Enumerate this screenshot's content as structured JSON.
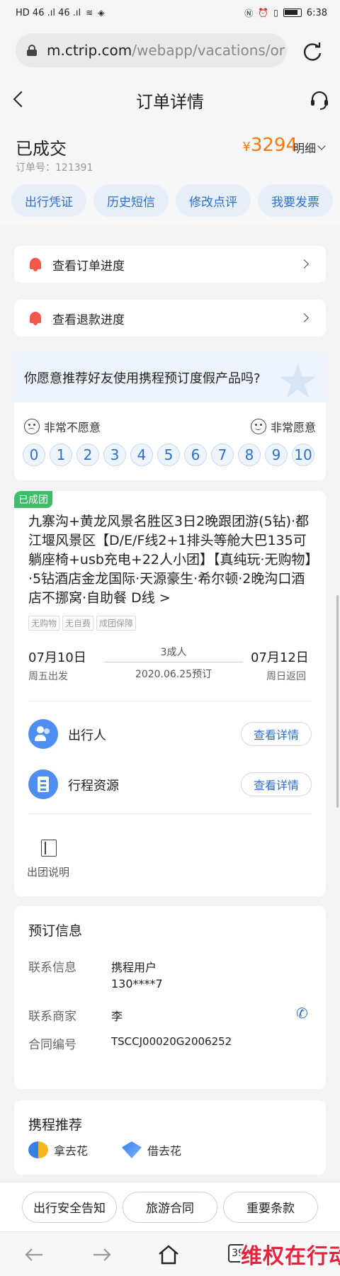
{
  "statusbar": {
    "left": "HD  46 .ıl  46 .ıl",
    "time": "6:38"
  },
  "url": {
    "host": "m.ctrip.com",
    "path": "/webapp/vacations/or"
  },
  "header": {
    "title": "订单详情"
  },
  "summary": {
    "status": "已成交",
    "order_label": "订单号：",
    "order_no": "121391",
    "price_currency": "¥",
    "price": "3294",
    "detail_label": "明细",
    "actions": [
      "出行凭证",
      "历史短信",
      "修改点评",
      "我要发票"
    ]
  },
  "progress": {
    "order": "查看订单进度",
    "refund": "查看退款进度"
  },
  "survey": {
    "question": "你愿意推荐好友使用携程预订度假产品吗?",
    "low_label": "非常不愿意",
    "high_label": "非常愿意",
    "scale": [
      "0",
      "1",
      "2",
      "3",
      "4",
      "5",
      "6",
      "7",
      "8",
      "9",
      "10"
    ]
  },
  "product": {
    "badge": "已成团",
    "title": "九寨沟+黄龙风景名胜区3日2晚跟团游(5钻)·都江堰风景区【D/E/F线2+1排头等舱大巴135可躺座椅+usb充电+22人小团】【真纯玩·无购物】·5钻酒店金龙国际·天源豪生·希尔顿·2晚沟口酒店不挪窝·自助餐 D线 >",
    "chips": [
      "无购物",
      "无自费",
      "成团保障"
    ],
    "start_date": "07月10日",
    "start_week": "周五出发",
    "people": "3成人",
    "booked": "2020.06.25预订",
    "end_date": "07月12日",
    "end_week": "周日返回",
    "traveler_label": "出行人",
    "resource_label": "行程资源",
    "view_details": "查看详情",
    "tour_notes": "出团说明"
  },
  "booking": {
    "title": "预订信息",
    "contact_label": "联系信息",
    "contact_name": "携程用户",
    "contact_phone": "130****7",
    "merchant_label": "联系商家",
    "merchant_name": "李",
    "contract_label": "合同编号",
    "contract_no": "TSCCJ00020G2006252"
  },
  "recommend": {
    "title": "携程推荐",
    "items": [
      "拿去花",
      "借去花"
    ]
  },
  "bottom": {
    "buttons": [
      "出行安全告知",
      "旅游合同",
      "重要条款"
    ]
  },
  "nav": {
    "tabs": "39"
  },
  "watermark": "维权在行动",
  "colors": {
    "accent": "#2f6fcb",
    "price": "#ff7700",
    "alert": "#f2584a",
    "success": "#3fbb6a"
  }
}
